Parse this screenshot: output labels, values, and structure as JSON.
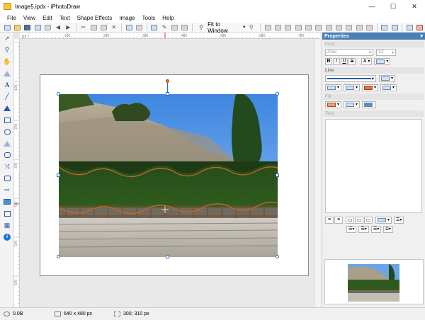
{
  "window": {
    "title": "Image5.ipdx - iPhotoDraw",
    "minimize": "—",
    "maximize": "☐",
    "close": "✕"
  },
  "menu": [
    "File",
    "View",
    "Edit",
    "Text",
    "Shape Effects",
    "Image",
    "Tools",
    "Help"
  ],
  "toolbar": {
    "zoom_label": "Fit to Window"
  },
  "ruler": {
    "unit": "px",
    "h_ticks": [
      "100",
      "200",
      "300",
      "400",
      "500",
      "600",
      "700"
    ],
    "v_ticks": [
      "100",
      "200",
      "300",
      "400",
      "500",
      "600"
    ]
  },
  "properties": {
    "title": "Properties",
    "font_section": "Font",
    "font_name": "Arial",
    "font_size": "12",
    "style_buttons": [
      "B",
      "I",
      "U",
      "S"
    ],
    "line_section": "Line",
    "fill_section": "Fill",
    "text_section": "Text"
  },
  "status": {
    "file_size": "0.0B",
    "dimensions": "640 x 480 px",
    "cursor": "300; 310 px"
  },
  "colors": {
    "accent": "#2a5aa8",
    "panel_header": "#4a7fb8",
    "selection": "#1f6fc7",
    "wave": "#c8662a"
  }
}
